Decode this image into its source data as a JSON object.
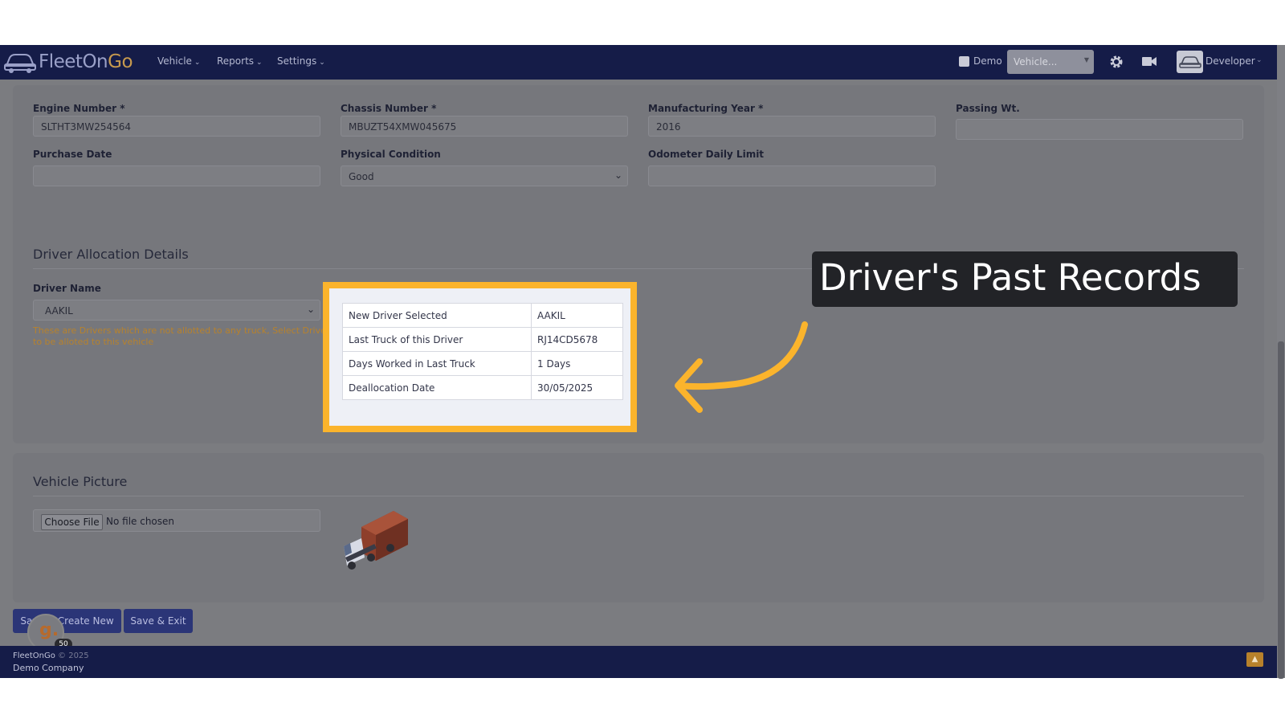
{
  "navbar": {
    "logo_text_a": "FleetOn",
    "logo_text_b": "Go",
    "menu": [
      "Vehicle",
      "Reports",
      "Settings"
    ],
    "demo_label": "Demo",
    "vehicle_select_placeholder": "Vehicle...",
    "user_label": "Developer"
  },
  "vehicle_details": {
    "engine_number_label": "Engine Number *",
    "engine_number_value": "SLTHT3MW254564",
    "chassis_number_label": "Chassis Number *",
    "chassis_number_value": "MBUZT54XMW045675",
    "manufacturing_year_label": "Manufacturing Year *",
    "manufacturing_year_value": "2016",
    "passing_wt_label": "Passing Wt.",
    "passing_wt_value": "",
    "purchase_date_label": "Purchase Date",
    "purchase_date_value": "",
    "physical_condition_label": "Physical Condition",
    "physical_condition_value": "Good",
    "odometer_daily_limit_label": "Odometer Daily Limit",
    "odometer_daily_limit_value": ""
  },
  "driver_allocation": {
    "title": "Driver Allocation Details",
    "driver_name_label": "Driver Name",
    "driver_name_value": "AAKIL",
    "hint_line1": "These are Drivers which are not allotted to any truck, Select Driver",
    "hint_line2": "to be alloted to this vehicle",
    "records": [
      {
        "key": "New Driver Selected",
        "value": "AAKIL"
      },
      {
        "key": "Last Truck of this Driver",
        "value": "RJ14CD5678"
      },
      {
        "key": "Days Worked in Last Truck",
        "value": "1 Days"
      },
      {
        "key": "Deallocation Date",
        "value": "30/05/2025"
      }
    ]
  },
  "annotation": {
    "callout": "Driver's Past Records",
    "highlight_color": "#fbb42c"
  },
  "vehicle_picture": {
    "title": "Vehicle Picture",
    "choose_file": "Choose File",
    "no_file": "No file chosen"
  },
  "actions": {
    "save_create_new": "Save & Create New",
    "save_exit": "Save & Exit",
    "guidde_count": "50"
  },
  "footer": {
    "brand": "FleetOnGo",
    "year": "© 2025",
    "company": "Demo Company"
  }
}
